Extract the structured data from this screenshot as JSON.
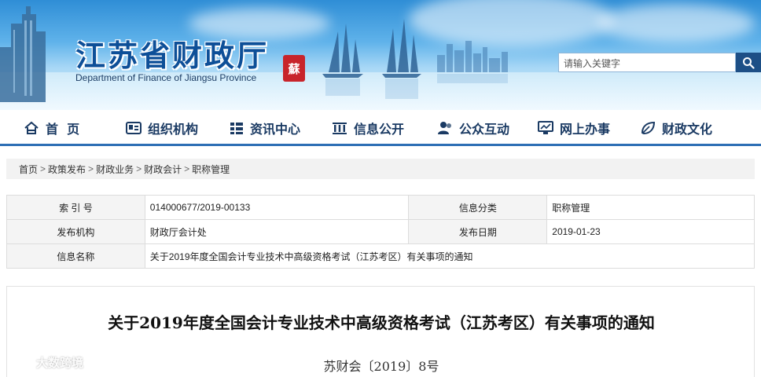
{
  "header": {
    "title": "江苏省财政厅",
    "subtitle": "Department of Finance of Jiangsu Province",
    "seal_text": "蘇"
  },
  "search": {
    "placeholder": "请输入关键字",
    "button_icon": "search-icon"
  },
  "nav": {
    "items": [
      {
        "label": "首  页",
        "icon": "home-icon"
      },
      {
        "label": "组织机构",
        "icon": "id-card-icon"
      },
      {
        "label": "资讯中心",
        "icon": "list-icon"
      },
      {
        "label": "信息公开",
        "icon": "building-icon"
      },
      {
        "label": "公众互动",
        "icon": "people-icon"
      },
      {
        "label": "网上办事",
        "icon": "monitor-icon"
      },
      {
        "label": "财政文化",
        "icon": "leaf-icon"
      }
    ]
  },
  "breadcrumb": {
    "items": [
      "首页",
      "政策发布",
      "财政业务",
      "财政会计",
      "职称管理"
    ],
    "separator": ">"
  },
  "info": {
    "index_label": "索 引 号",
    "index_value": "014000677/2019-00133",
    "category_label": "信息分类",
    "category_value": "职称管理",
    "publisher_label": "发布机构",
    "publisher_value": "财政厅会计处",
    "date_label": "发布日期",
    "date_value": "2019-01-23",
    "name_label": "信息名称",
    "name_value": "关于2019年度全国会计专业技术中高级资格考试（江苏考区）有关事项的通知"
  },
  "notice": {
    "title": "关于2019年度全国会计专业技术中高级资格考试（江苏考区）有关事项的通知",
    "doc_number": "苏财会〔2019〕8号"
  },
  "watermark": {
    "text": "大数跨境"
  },
  "colors": {
    "title_blue": "#0d4f98",
    "nav_text": "#1a3a63",
    "nav_border": "#2d6fb5",
    "seal_red": "#c8242b",
    "search_button": "#1d4f86"
  }
}
